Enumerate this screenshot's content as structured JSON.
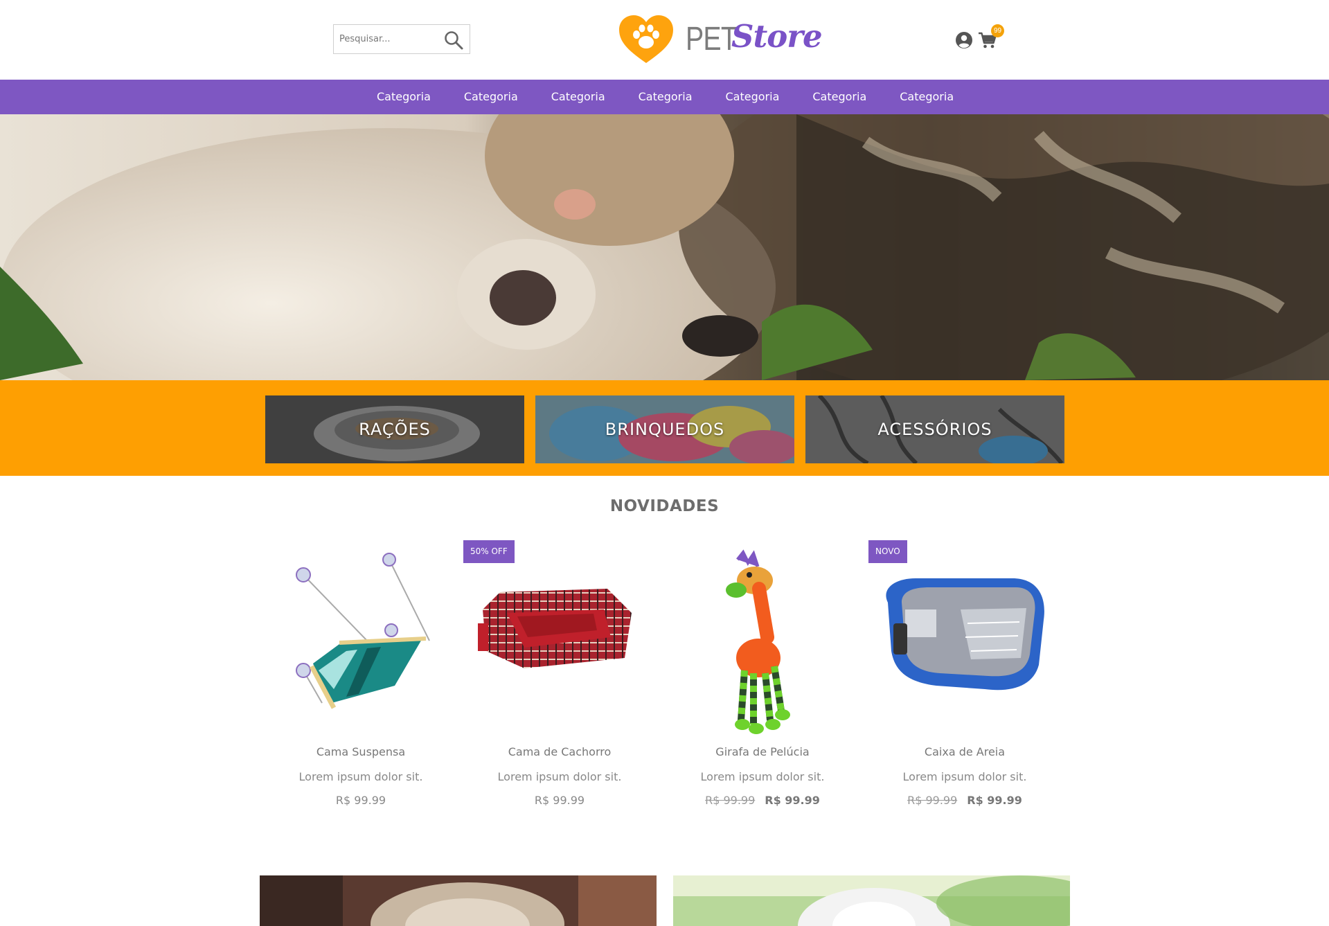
{
  "header": {
    "search_placeholder": "Pesquisar...",
    "logo_pet": "PET",
    "logo_store": "Store",
    "cart_count": "99"
  },
  "nav": {
    "items": [
      "Categoria",
      "Categoria",
      "Categoria",
      "Categoria",
      "Categoria",
      "Categoria",
      "Categoria"
    ]
  },
  "categories": [
    {
      "label": "RAÇÕES"
    },
    {
      "label": "BRINQUEDOS"
    },
    {
      "label": "ACESSÓRIOS"
    }
  ],
  "section_title": "NOVIDADES",
  "products": [
    {
      "name": "Cama Suspensa",
      "desc": "Lorem ipsum dolor sit.",
      "price": "R$ 99.99",
      "old_price": "",
      "tag": ""
    },
    {
      "name": "Cama de Cachorro",
      "desc": "Lorem ipsum dolor sit.",
      "price": "R$ 99.99",
      "old_price": "",
      "tag": "50% OFF"
    },
    {
      "name": "Girafa de Pelúcia",
      "desc": "Lorem ipsum dolor sit.",
      "price": "R$ 99.99",
      "old_price": "R$ 99.99",
      "tag": ""
    },
    {
      "name": "Caixa de Areia",
      "desc": "Lorem ipsum dolor sit.",
      "price": "R$ 99.99",
      "old_price": "R$ 99.99",
      "tag": "NOVO"
    }
  ],
  "colors": {
    "brand_purple": "#7e57c2",
    "brand_orange": "#fe9f02",
    "text_gray": "#777777"
  },
  "icons": [
    "search-icon",
    "user-icon",
    "cart-icon",
    "heart-paw-logo-icon"
  ]
}
